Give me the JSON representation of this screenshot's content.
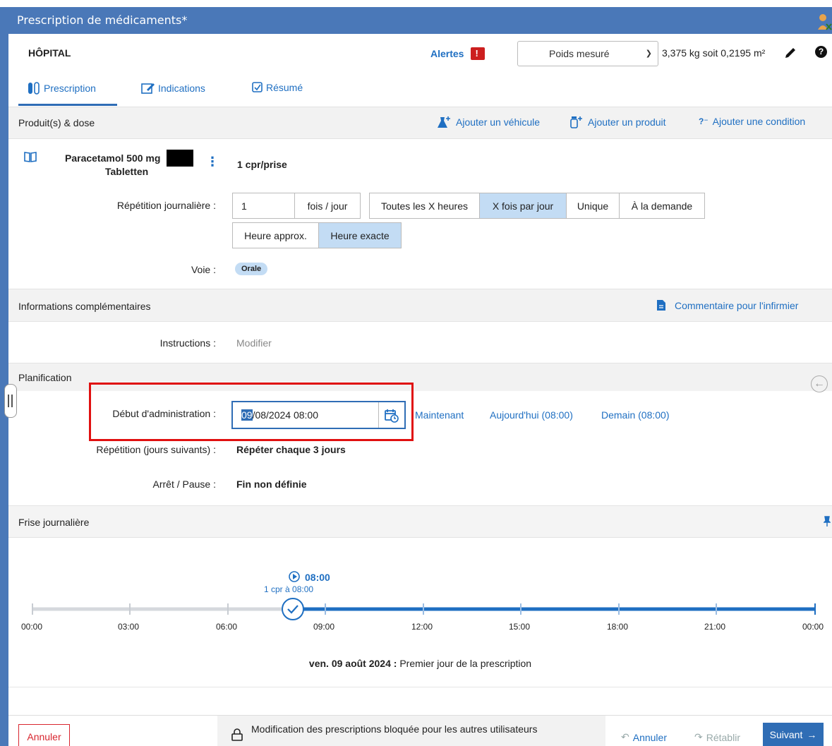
{
  "window": {
    "title": "Prescription de médicaments*"
  },
  "header": {
    "hospital": "HÔPITAL",
    "alerts_label": "Alertes",
    "weight_select_value": "Poids mesuré",
    "weight_value": "3,375 kg soit 0,2195 m²",
    "help": "?"
  },
  "tabs": [
    {
      "label": "Prescription"
    },
    {
      "label": "Indications"
    },
    {
      "label": "Résumé"
    }
  ],
  "product_section": {
    "title": "Produit(s) & dose",
    "add_vehicle": "Ajouter un véhicule",
    "add_product": "Ajouter un produit",
    "add_condition": "Ajouter une condition",
    "product_name": "Paracetamol 500 mg",
    "product_form": "Tabletten",
    "dose": "1 cpr/prise",
    "daily_repetition_label": "Répétition journalière :",
    "daily_count": "1",
    "daily_unit": "fois / jour",
    "frequency_options": [
      "Toutes les X heures",
      "X fois par jour",
      "Unique",
      "À la demande"
    ],
    "frequency_selected": "X fois par jour",
    "time_options": [
      "Heure approx.",
      "Heure exacte"
    ],
    "time_selected": "Heure exacte",
    "route_label": "Voie :",
    "route_value": "Orale"
  },
  "info_section": {
    "title": "Informations complémentaires",
    "nurse_comment": "Commentaire pour l'infirmier",
    "instructions_label": "Instructions :",
    "instructions_value": "Modifier"
  },
  "planning_section": {
    "title": "Planification",
    "start_label": "Début d'administration :",
    "start_value_highlight": "09",
    "start_value_rest": "/08/2024 08:00",
    "now": "Maintenant",
    "today": "Aujourd'hui (08:00)",
    "tomorrow": "Demain (08:00)",
    "repeat_label": "Répétition (jours suivants) :",
    "repeat_value": "Répéter chaque 3 jours",
    "stop_label": "Arrêt / Pause :",
    "stop_value": "Fin non définie"
  },
  "daily_strip": {
    "title": "Frise journalière",
    "marker_time": "08:00",
    "marker_caption": "1 cpr à 08:00",
    "ticks": [
      "00:00",
      "03:00",
      "06:00",
      "09:00",
      "12:00",
      "15:00",
      "18:00",
      "21:00",
      "00:00"
    ],
    "date_bold": "ven. 09 août 2024 :",
    "date_caption": "Premier jour de la prescription"
  },
  "footer": {
    "cancel": "Annuler",
    "lock_message": "Modification des prescriptions bloquée pour les autres utilisateurs",
    "undo": "Annuler",
    "redo": "Rétablir",
    "next": "Suivant"
  },
  "colors": {
    "accent": "#2f6db5",
    "titlebar": "#4a78b8",
    "selected": "#c3dcf4",
    "alert": "#cc1f1f",
    "highlight_box": "#e01010"
  }
}
